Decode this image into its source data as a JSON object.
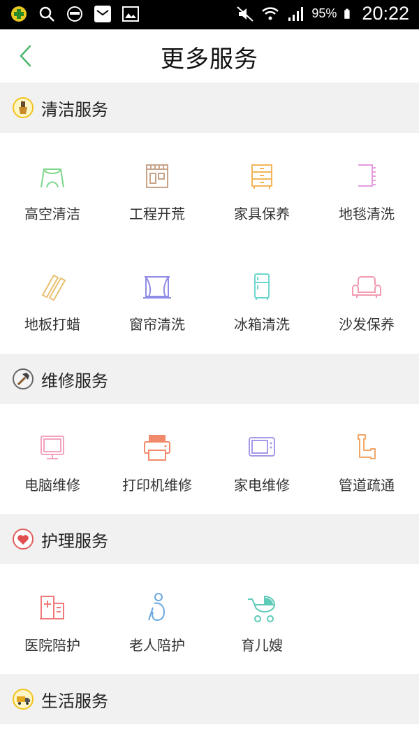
{
  "status_bar": {
    "battery": "95%",
    "time": "20:22"
  },
  "header": {
    "title": "更多服务",
    "back_icon": "chevron-left-icon",
    "accent": "#4cb66a"
  },
  "sections": [
    {
      "title": "清洁服务",
      "icon": "broom-icon",
      "items": [
        {
          "label": "高空清洁",
          "icon": "high-altitude-icon",
          "color": "#7ed68a"
        },
        {
          "label": "工程开荒",
          "icon": "building-icon",
          "color": "#c8a58a"
        },
        {
          "label": "家具保养",
          "icon": "cabinet-icon",
          "color": "#f2b55a"
        },
        {
          "label": "地毯清洗",
          "icon": "carpet-icon",
          "color": "#e39de0"
        },
        {
          "label": "地板打蜡",
          "icon": "floorboard-icon",
          "color": "#e8c070"
        },
        {
          "label": "窗帘清洗",
          "icon": "curtain-icon",
          "color": "#8f8ce6"
        },
        {
          "label": "冰箱清洗",
          "icon": "fridge-icon",
          "color": "#6fd6cf"
        },
        {
          "label": "沙发保养",
          "icon": "sofa-icon",
          "color": "#f39ab0"
        }
      ]
    },
    {
      "title": "维修服务",
      "icon": "hammer-icon",
      "items": [
        {
          "label": "电脑维修",
          "icon": "monitor-icon",
          "color": "#f3a3c0"
        },
        {
          "label": "打印机维修",
          "icon": "printer-icon",
          "color": "#f08a6a"
        },
        {
          "label": "家电维修",
          "icon": "tv-icon",
          "color": "#a59ae8"
        },
        {
          "label": "管道疏通",
          "icon": "pipe-icon",
          "color": "#f2a86a"
        }
      ]
    },
    {
      "title": "护理服务",
      "icon": "heart-icon",
      "items": [
        {
          "label": "医院陪护",
          "icon": "hospital-icon",
          "color": "#f07a7a"
        },
        {
          "label": "老人陪护",
          "icon": "elder-icon",
          "color": "#6aa7e0"
        },
        {
          "label": "育儿嫂",
          "icon": "stroller-icon",
          "color": "#5ecab8"
        }
      ]
    },
    {
      "title": "生活服务",
      "icon": "truck-icon",
      "items": []
    }
  ]
}
